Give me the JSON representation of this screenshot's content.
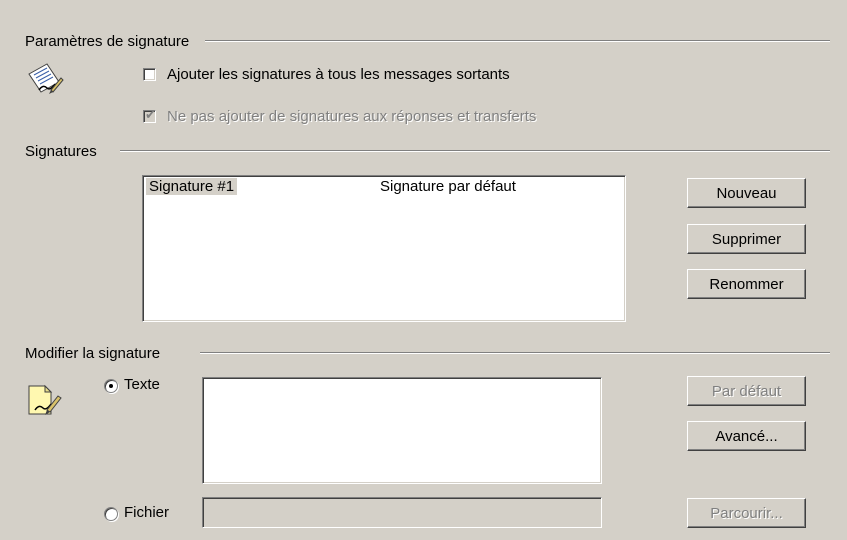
{
  "sections": {
    "settings_title": "Paramètres de signature",
    "signatures_title": "Signatures",
    "edit_title": "Modifier la signature"
  },
  "options": {
    "add_to_all": {
      "label": "Ajouter les signatures à tous les messages sortants",
      "checked": false
    },
    "no_replies": {
      "label": "Ne pas ajouter de signatures aux réponses et transferts",
      "checked": true,
      "disabled": true
    }
  },
  "signatures_list": {
    "rows": [
      {
        "name": "Signature #1",
        "note": "Signature par défaut",
        "selected": true
      }
    ]
  },
  "buttons": {
    "new": "Nouveau",
    "delete": "Supprimer",
    "rename": "Renommer",
    "default": "Par défaut",
    "advanced": "Avancé...",
    "browse": "Parcourir..."
  },
  "edit": {
    "text_option": "Texte",
    "file_option": "Fichier",
    "selected_option": "text",
    "text_value": "",
    "file_value": ""
  },
  "icons": {
    "settings_icon": "signature-document-icon",
    "edit_icon": "edit-signature-icon"
  }
}
